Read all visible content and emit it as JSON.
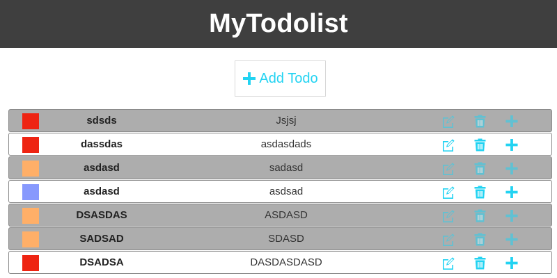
{
  "app": {
    "title": "MyTodolist"
  },
  "toolbar": {
    "add_label": "Add Todo"
  },
  "colors": {
    "accent": "#22d3f2",
    "header_bg": "#3f3f3f",
    "done_row_bg": "#adadad",
    "priority_red": "#ee2412",
    "priority_orange": "#ffaf68",
    "priority_blue": "#8799fd"
  },
  "icons": [
    "plus-icon",
    "edit-icon",
    "trash-icon"
  ],
  "todos": [
    {
      "title": "sdsds",
      "description": "Jsjsj",
      "color": "#ee2412",
      "done": true
    },
    {
      "title": "dassdas",
      "description": "asdasdads",
      "color": "#ee2412",
      "done": false
    },
    {
      "title": "asdasd",
      "description": "sadasd",
      "color": "#ffaf68",
      "done": true
    },
    {
      "title": "asdasd",
      "description": "asdsad",
      "color": "#8799fd",
      "done": false
    },
    {
      "title": "DSASDAS",
      "description": "ASDASD",
      "color": "#ffaf68",
      "done": true
    },
    {
      "title": "SADSAD",
      "description": "SDASD",
      "color": "#ffaf68",
      "done": true
    },
    {
      "title": "DSADSA",
      "description": "DASDASDASD",
      "color": "#ee2412",
      "done": false
    }
  ]
}
